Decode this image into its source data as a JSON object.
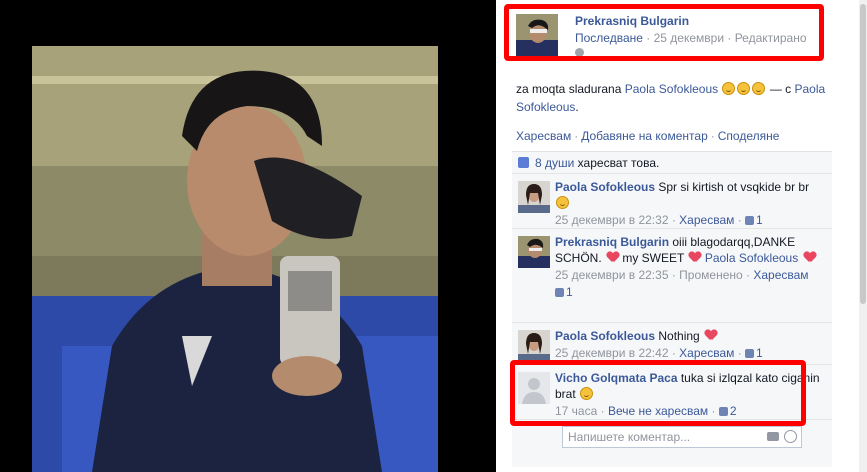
{
  "post": {
    "author": "Prekrasniq Bulgarin",
    "meta_follow": "Последване",
    "meta_sep": " · ",
    "meta_date": "25 декември",
    "meta_edited": "Редактирано",
    "text_before": "za moqta sladurana ",
    "text_tag1": "Paola Sofokleous",
    "text_with": " — с ",
    "text_tag2": "Paola Sofokleous",
    "text_end": ".",
    "actions": {
      "like": "Харесвам",
      "comment": "Добавяне на коментар",
      "share": "Споделяне"
    },
    "likes_count": "8 души",
    "likes_text": " харесват това."
  },
  "comments": [
    {
      "author": "Paola Sofokleous",
      "text": " Spr si kirtish ot vsqkide br br",
      "time": "25 декември в 22:32",
      "like": "Харесвам",
      "likes": "1"
    },
    {
      "author": "Prekrasniq Bulgarin",
      "text": " oiii blagodarqq,DANKE SCHÖN.",
      "text2": " my SWEET ",
      "tag": "Paola Sofokleous",
      "time": "25 декември в 22:35",
      "edited": "Променено",
      "like": "Харесвам",
      "likes": "1"
    },
    {
      "author": "Paola Sofokleous",
      "text": " Nothing ",
      "time": "25 декември в 22:42",
      "like": "Харесвам",
      "likes": "1"
    },
    {
      "author": "Vicho Golqmata Paca",
      "text": " tuka si izlqzal kato ciganin brat ",
      "time": "17 часа",
      "like": "Вече не харесвам",
      "likes": "2"
    }
  ],
  "composer": {
    "placeholder": "Напишете коментар..."
  },
  "colors": {
    "highlight": "#ff0000",
    "link": "#3b5998"
  }
}
